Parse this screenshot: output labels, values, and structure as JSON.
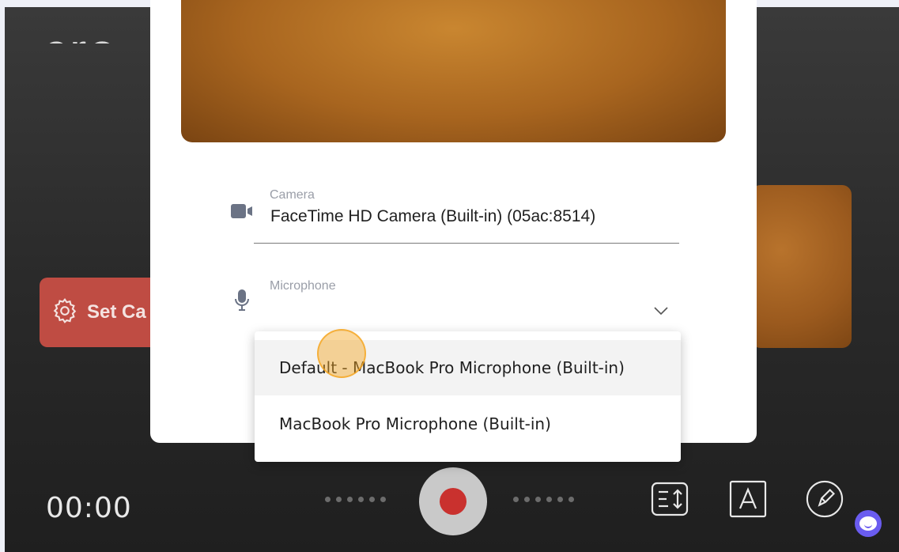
{
  "background": {
    "title_fragment": "cre",
    "set_camera_label": "Set Ca",
    "timer": "00:00"
  },
  "modal": {
    "camera": {
      "label": "Camera",
      "value": "FaceTime HD Camera (Built-in) (05ac:8514)",
      "icon": "video-camera-icon"
    },
    "microphone": {
      "label": "Microphone",
      "value": "",
      "icon": "microphone-icon"
    }
  },
  "dropdown": {
    "options": [
      "Default - MacBook Pro Microphone (Built-in)",
      "MacBook Pro Microphone (Built-in)"
    ],
    "highlighted_index": 0
  },
  "toolbar": {
    "icons": [
      "teleprompter-icon",
      "text-overlay-icon",
      "draw-icon"
    ]
  },
  "colors": {
    "record": "#c9312e",
    "set_camera_button": "#bf4c43",
    "accent_cursor": "#f5a623",
    "assistant": "#6a5cf0"
  }
}
